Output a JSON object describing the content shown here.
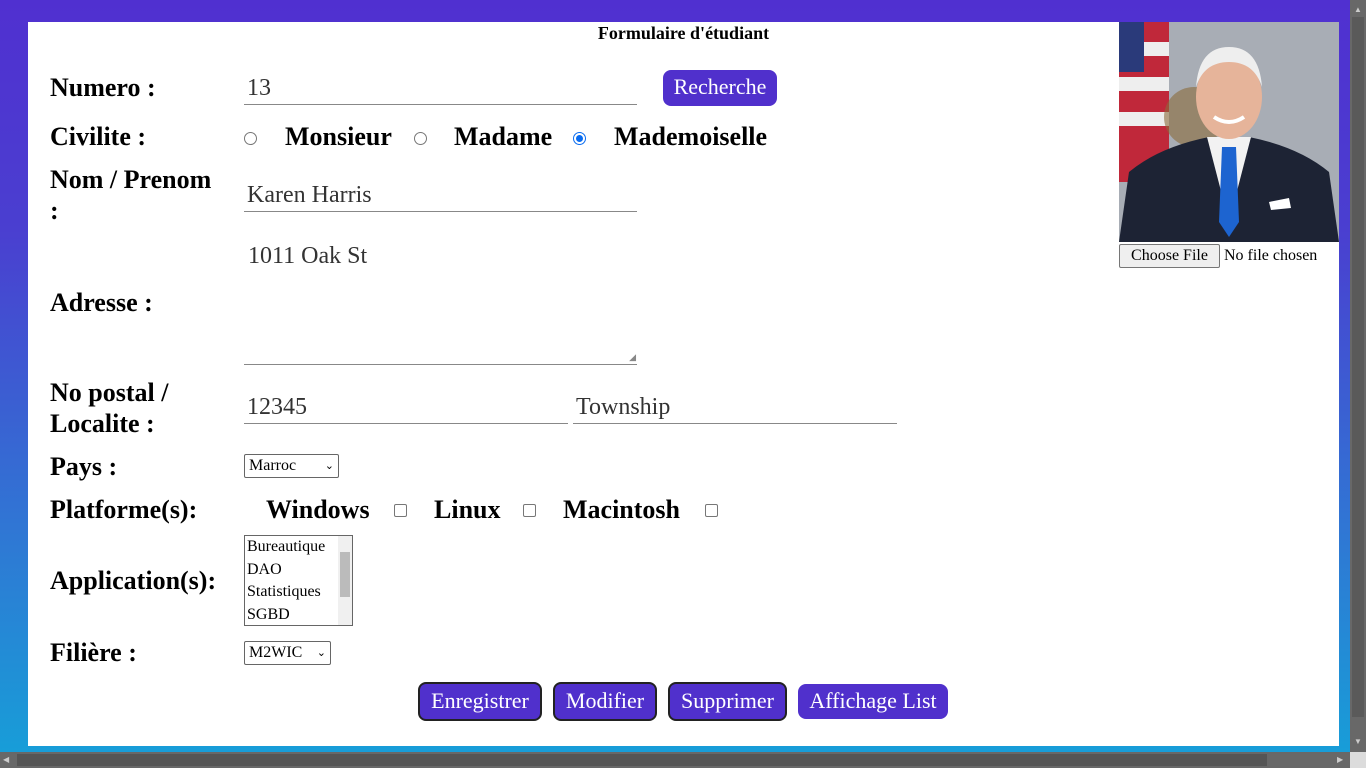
{
  "form": {
    "title": "Formulaire d'étudiant",
    "numero": {
      "label": "Numero :",
      "value": "13",
      "search_button": "Recherche"
    },
    "civilite": {
      "label": "Civilite :",
      "options": [
        "Monsieur",
        "Madame",
        "Mademoiselle"
      ],
      "selected": "Mademoiselle"
    },
    "nom": {
      "label_line1": "Nom / Prenom",
      "label_line2": ":",
      "value": "Karen Harris"
    },
    "adresse": {
      "label": "Adresse :",
      "value": "1011 Oak St"
    },
    "postal": {
      "label_line1": "No postal /",
      "label_line2": "Localite :",
      "code": "12345",
      "localite": "Township"
    },
    "pays": {
      "label": "Pays :",
      "value": "Marroc"
    },
    "platformes": {
      "label": "Platforme(s):",
      "options": [
        "Windows",
        "Linux",
        "Macintosh"
      ]
    },
    "applications": {
      "label": "Application(s):",
      "options": [
        "Bureautique",
        "DAO",
        "Statistiques",
        "SGBD"
      ]
    },
    "filiere": {
      "label": "Filière :",
      "value": "M2WIC"
    },
    "buttons": {
      "save": "Enregistrer",
      "edit": "Modifier",
      "delete": "Supprimer",
      "list": "Affichage List"
    },
    "photo": {
      "choose_file": "Choose File",
      "no_file": "No file chosen"
    }
  },
  "colors": {
    "accent": "#5030cc",
    "radio_checked": "#0a6cf0"
  }
}
